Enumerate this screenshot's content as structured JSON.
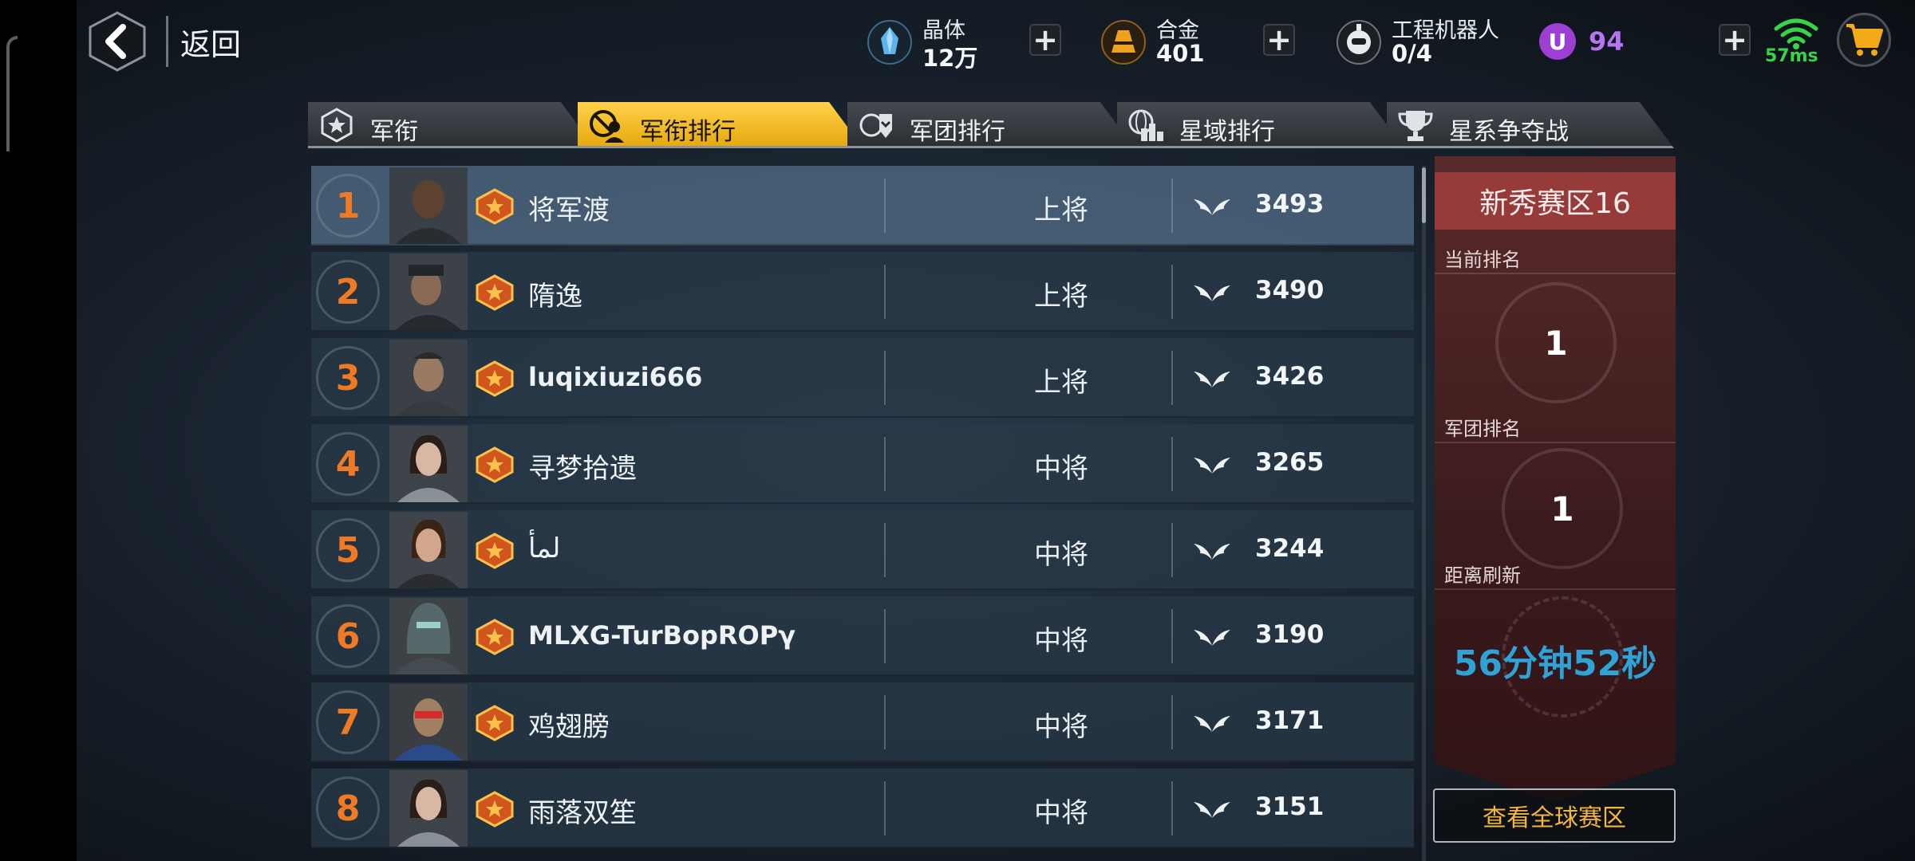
{
  "topbar": {
    "back_label": "返回",
    "crystal": {
      "name": "晶体",
      "value": "12万",
      "color": "#5ab3ea"
    },
    "alloy": {
      "name": "合金",
      "value": "401",
      "color": "#f0a21e"
    },
    "robot": {
      "name": "工程机器人",
      "value": "0/4"
    },
    "u_icon_text": "U",
    "u_value": "94",
    "ping": "57ms",
    "plus": "+"
  },
  "tabs": [
    {
      "label": "军衔",
      "icon": "rank-emblem-icon",
      "active": false
    },
    {
      "label": "军衔排行",
      "icon": "rank-leaderboard-icon",
      "active": true
    },
    {
      "label": "军团排行",
      "icon": "legion-rank-icon",
      "active": false
    },
    {
      "label": "星域排行",
      "icon": "star-domain-rank-icon",
      "active": false
    },
    {
      "label": "星系争夺战",
      "icon": "trophy-icon",
      "active": false
    }
  ],
  "rows": [
    {
      "rank": "1",
      "name": "将军渡",
      "title": "上将",
      "score": "3493"
    },
    {
      "rank": "2",
      "name": "隋逸",
      "title": "上将",
      "score": "3490"
    },
    {
      "rank": "3",
      "name": "luqixiuzi666",
      "title": "上将",
      "score": "3426"
    },
    {
      "rank": "4",
      "name": "寻梦拾遗",
      "title": "中将",
      "score": "3265"
    },
    {
      "rank": "5",
      "name": "لمأ",
      "title": "中将",
      "score": "3244"
    },
    {
      "rank": "6",
      "name": "MLXG-TurBopROPγ",
      "title": "中将",
      "score": "3190"
    },
    {
      "rank": "7",
      "name": "鸡翅膀",
      "title": "中将",
      "score": "3171"
    },
    {
      "rank": "8",
      "name": "雨落双笙",
      "title": "中将",
      "score": "3151"
    }
  ],
  "side": {
    "zone": "新秀赛区16",
    "current_rank_label": "当前排名",
    "current_rank": "1",
    "legion_rank_label": "军团排名",
    "legion_rank": "1",
    "refresh_label": "距离刷新",
    "refresh_time": "56分钟52秒",
    "global_button": "查看全球赛区"
  },
  "colors": {
    "rank_number": "#f07a24",
    "active_tab": "#f5bd22",
    "zone_header": "#973b3a",
    "timer": "#2fa2d6",
    "global_button_text": "#f4b63c",
    "u_value": "#b774f2",
    "ping": "#37d44a"
  }
}
